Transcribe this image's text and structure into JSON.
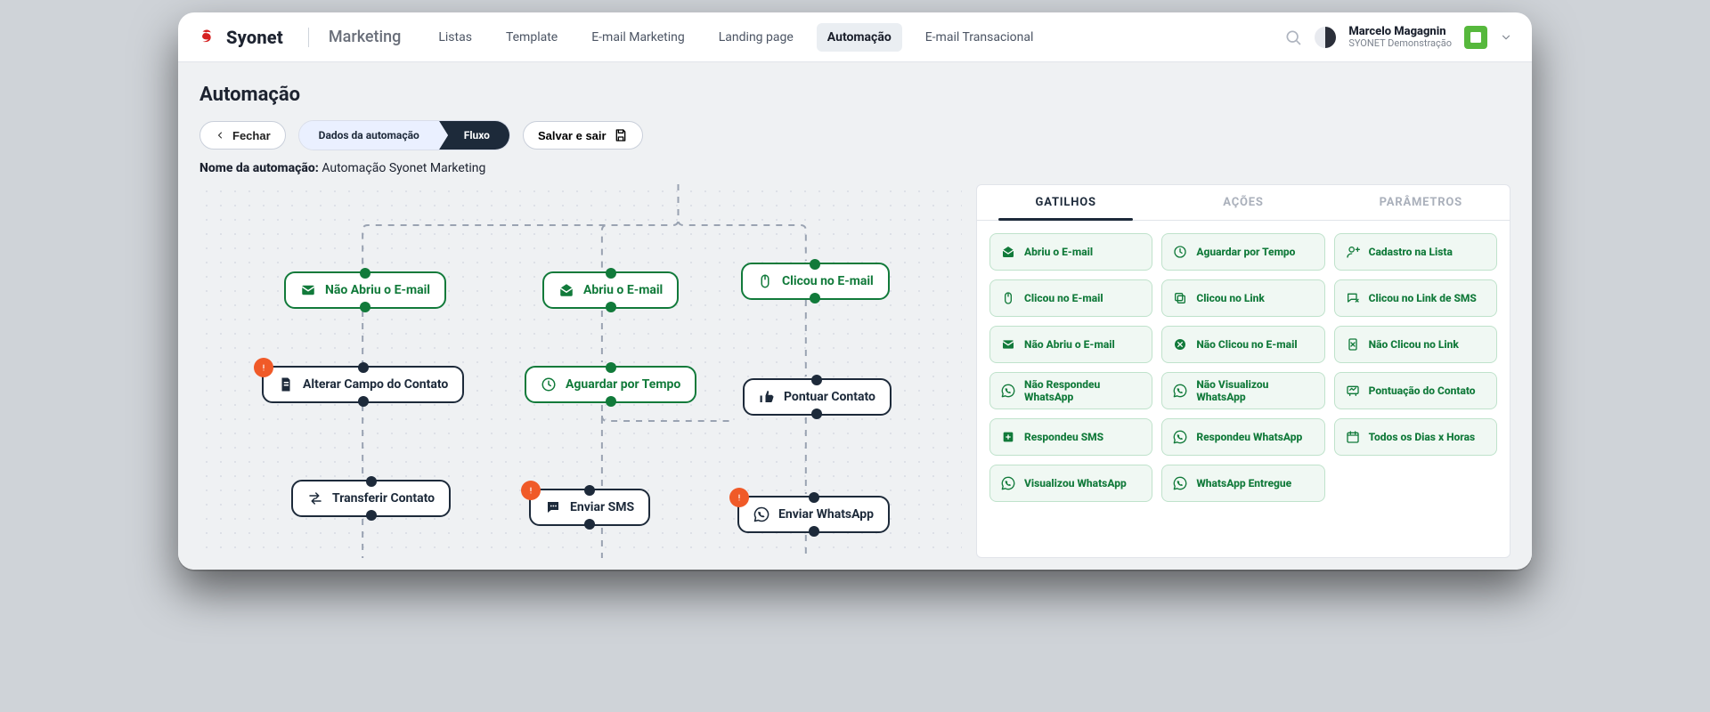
{
  "brand": {
    "name": "Syonet",
    "module": "Marketing"
  },
  "nav": {
    "items": [
      {
        "label": "Listas"
      },
      {
        "label": "Template"
      },
      {
        "label": "E-mail Marketing"
      },
      {
        "label": "Landing page"
      },
      {
        "label": "Automação",
        "active": true
      },
      {
        "label": "E-mail Transacional"
      }
    ]
  },
  "user": {
    "name": "Marcelo Magagnin",
    "org": "SYONET Demonstração"
  },
  "page": {
    "title": "Automação"
  },
  "toolbar": {
    "close": "Fechar",
    "step1": "Dados da automação",
    "step2": "Fluxo",
    "save": "Salvar e sair"
  },
  "automation": {
    "label": "Nome da automação:",
    "value": "Automação Syonet Marketing"
  },
  "canvas": {
    "nodes": {
      "n1": "Não Abriu o E-mail",
      "n2": "Abriu o E-mail",
      "n3": "Clicou no E-mail",
      "a1": "Alterar Campo do Contato",
      "a2": "Aguardar por Tempo",
      "a3": "Pontuar Contato",
      "b1": "Transferir Contato",
      "b2": "Enviar SMS",
      "b3": "Enviar WhatsApp"
    }
  },
  "palette": {
    "tabs": {
      "triggers": "GATILHOS",
      "actions": "AÇÕES",
      "params": "PARÂMETROS"
    },
    "items": [
      {
        "icon": "mail-open",
        "label": "Abriu o E-mail"
      },
      {
        "icon": "clock",
        "label": "Aguardar por Tempo"
      },
      {
        "icon": "user-add",
        "label": "Cadastro na Lista"
      },
      {
        "icon": "mouse",
        "label": "Clicou no E-mail"
      },
      {
        "icon": "copy",
        "label": "Clicou no Link"
      },
      {
        "icon": "sms-link",
        "label": "Clicou no Link de SMS"
      },
      {
        "icon": "mail",
        "label": "Não Abriu o E-mail"
      },
      {
        "icon": "mail-x",
        "label": "Não Clicou no E-mail"
      },
      {
        "icon": "link-x",
        "label": "Não Clicou no Link"
      },
      {
        "icon": "whatsapp",
        "label": "Não Respondeu WhatsApp"
      },
      {
        "icon": "whatsapp",
        "label": "Não Visualizou WhatsApp"
      },
      {
        "icon": "score",
        "label": "Pontuação do Contato"
      },
      {
        "icon": "plus-square",
        "label": "Respondeu SMS"
      },
      {
        "icon": "whatsapp",
        "label": "Respondeu WhatsApp"
      },
      {
        "icon": "calendar",
        "label": "Todos os Dias x Horas"
      },
      {
        "icon": "whatsapp",
        "label": "Visualizou WhatsApp"
      },
      {
        "icon": "whatsapp",
        "label": "WhatsApp Entregue"
      }
    ]
  }
}
